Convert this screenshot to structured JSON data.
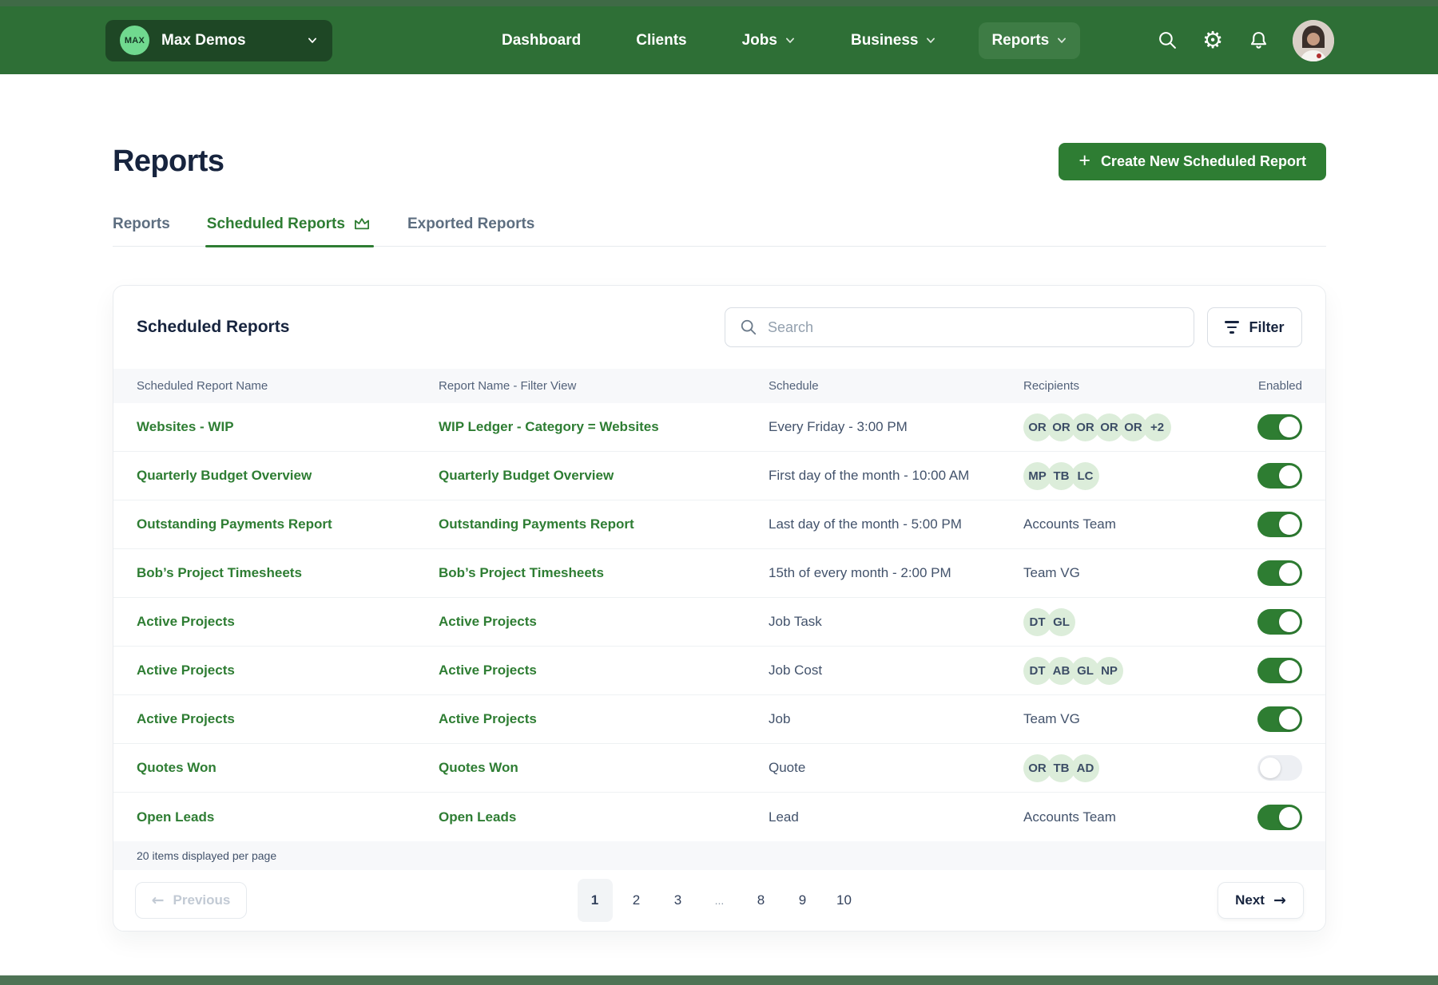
{
  "colors": {
    "nav_green": "#2e6f36",
    "accent_green": "#2e7d33",
    "toggle_on": "#2e7d32",
    "chip_bg": "#dcedda",
    "dark_text": "#17243e",
    "header_bg": "#f7f8fa"
  },
  "nav": {
    "org": {
      "logo_text": "MAX",
      "name": "Max Demos",
      "chevron_icon": "chevron-down-icon"
    },
    "items": [
      {
        "label": "Dashboard",
        "chevron": false,
        "active": false
      },
      {
        "label": "Clients",
        "chevron": false,
        "active": false
      },
      {
        "label": "Jobs",
        "chevron": true,
        "active": false
      },
      {
        "label": "Business",
        "chevron": true,
        "active": false
      },
      {
        "label": "Reports",
        "chevron": true,
        "active": true
      }
    ],
    "action_icons": [
      "search-icon",
      "settings-icon",
      "notifications-icon",
      "user-avatar"
    ]
  },
  "page": {
    "title": "Reports",
    "create_button": "Create New Scheduled Report"
  },
  "tabs": [
    {
      "label": "Reports",
      "active": false,
      "icon": null
    },
    {
      "label": "Scheduled Reports",
      "active": true,
      "icon": "crown-icon"
    },
    {
      "label": "Exported Reports",
      "active": false,
      "icon": null
    }
  ],
  "card": {
    "title": "Scheduled Reports",
    "search_placeholder": "Search",
    "filter_label": "Filter",
    "table": {
      "columns": [
        "Scheduled Report Name",
        "Report Name - Filter View",
        "Schedule",
        "Recipients",
        "Enabled"
      ],
      "rows": [
        {
          "name": "Websites - WIP",
          "view": "WIP Ledger - Category = Websites",
          "schedule": "Every Friday - 3:00 PM",
          "recipients": {
            "chips": [
              "OR",
              "OR",
              "OR",
              "OR",
              "OR",
              "+2"
            ]
          },
          "enabled": true
        },
        {
          "name": "Quarterly Budget Overview",
          "view": "Quarterly Budget Overview",
          "schedule": "First day of the month - 10:00 AM",
          "recipients": {
            "chips": [
              "MP",
              "TB",
              "LC"
            ]
          },
          "enabled": true
        },
        {
          "name": "Outstanding Payments Report",
          "view": "Outstanding Payments Report",
          "schedule": "Last day of the month - 5:00 PM",
          "recipients": {
            "text": "Accounts Team"
          },
          "enabled": true
        },
        {
          "name": "Bob’s Project Timesheets",
          "view": "Bob’s Project Timesheets",
          "schedule": "15th of every month - 2:00 PM",
          "recipients": {
            "text": "Team VG"
          },
          "enabled": true
        },
        {
          "name": "Active Projects",
          "view": "Active Projects",
          "schedule": "Job Task",
          "recipients": {
            "chips": [
              "DT",
              "GL"
            ]
          },
          "enabled": true
        },
        {
          "name": "Active Projects",
          "view": "Active Projects",
          "schedule": "Job Cost",
          "recipients": {
            "chips": [
              "DT",
              "AB",
              "GL",
              "NP"
            ]
          },
          "enabled": true
        },
        {
          "name": "Active Projects",
          "view": "Active Projects",
          "schedule": "Job",
          "recipients": {
            "text": "Team VG"
          },
          "enabled": true
        },
        {
          "name": "Quotes Won",
          "view": "Quotes Won",
          "schedule": "Quote",
          "recipients": {
            "chips": [
              "OR",
              "TB",
              "AD"
            ]
          },
          "enabled": false
        },
        {
          "name": "Open Leads",
          "view": "Open Leads",
          "schedule": "Lead",
          "recipients": {
            "text": "Accounts Team"
          },
          "enabled": true
        }
      ]
    },
    "footer_note": "20 items displayed per page",
    "pagination": {
      "previous": "Previous",
      "next": "Next",
      "pages": [
        "1",
        "2",
        "3",
        "...",
        "8",
        "9",
        "10"
      ],
      "active_page": "1"
    }
  }
}
